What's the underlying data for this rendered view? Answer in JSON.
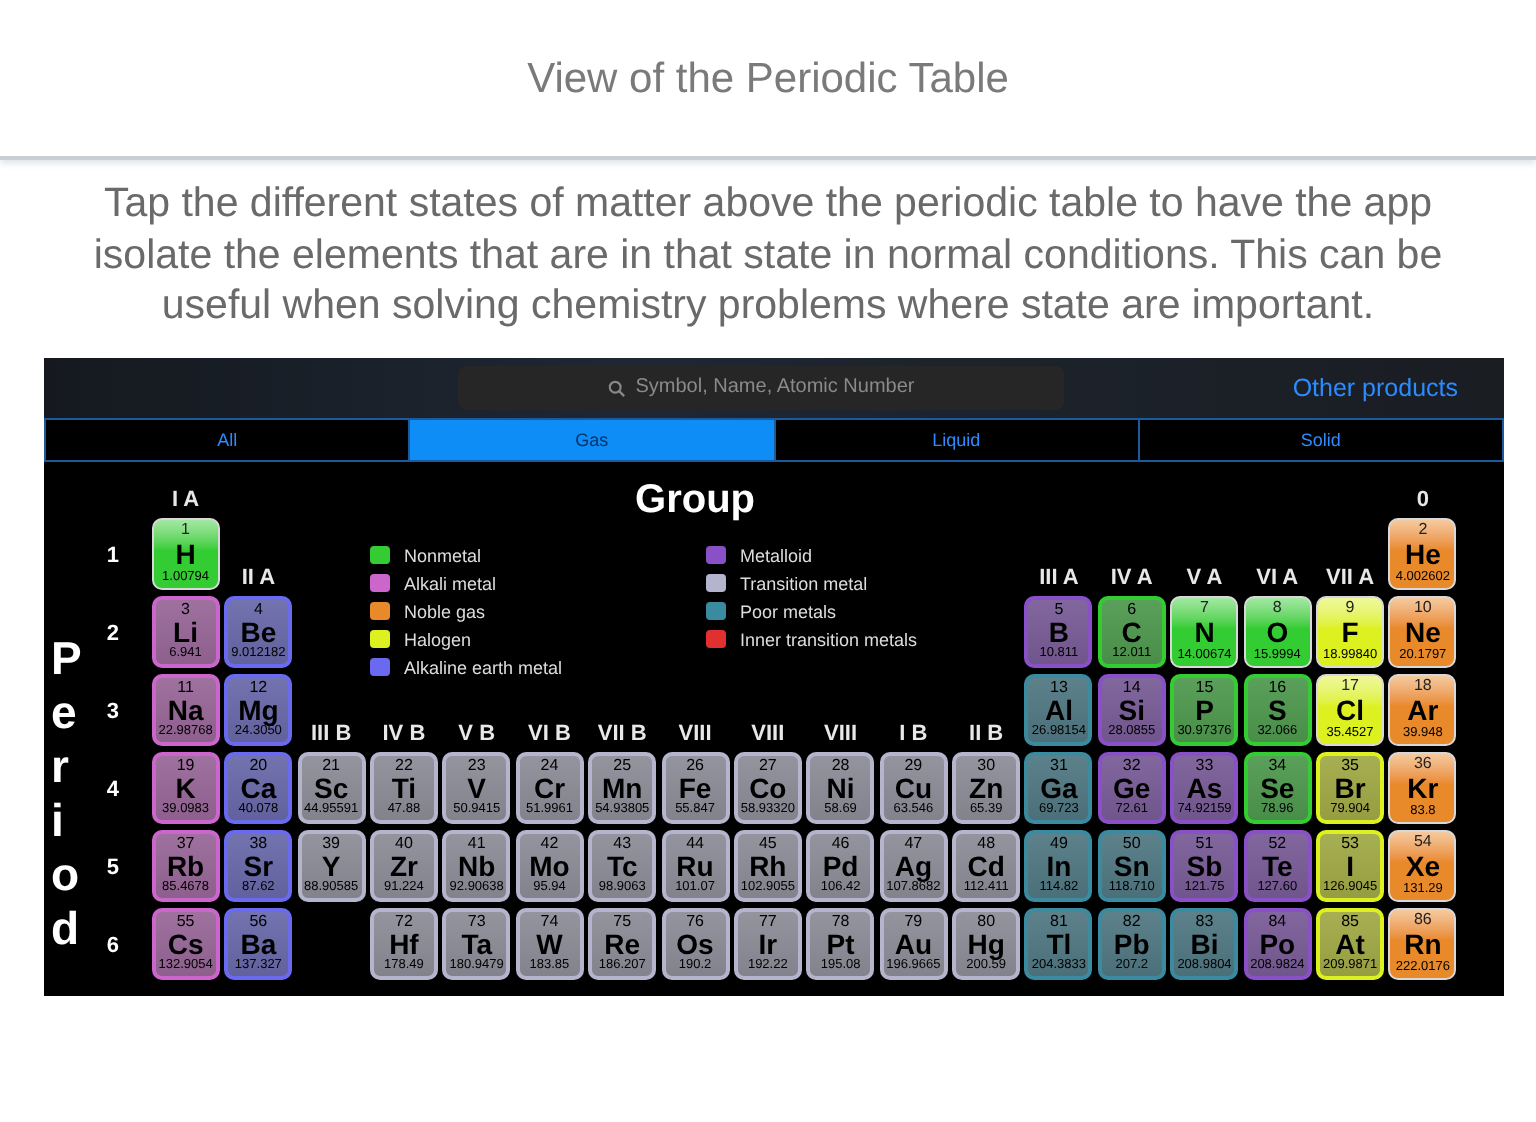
{
  "page_title": "View of the Periodic Table",
  "caption": "Tap the different states of matter above the periodic table to have the app isolate the elements that are in that state in normal conditions. This can be useful when solving chemistry problems where state are important.",
  "search": {
    "placeholder": "Symbol, Name, Atomic Number"
  },
  "other_products": "Other products",
  "tabs": [
    {
      "label": "All",
      "selected": false
    },
    {
      "label": "Gas",
      "selected": true
    },
    {
      "label": "Liquid",
      "selected": false
    },
    {
      "label": "Solid",
      "selected": false
    }
  ],
  "group_axis": "Group",
  "period_axis": "Period",
  "legend": [
    {
      "label": "Nonmetal",
      "color": "#33cc33"
    },
    {
      "label": "Alkali metal",
      "color": "#cc66cc"
    },
    {
      "label": "Noble gas",
      "color": "#e8892a"
    },
    {
      "label": "Halogen",
      "color": "#ddf020"
    },
    {
      "label": "Alkaline earth metal",
      "color": "#6a6af0"
    },
    {
      "label": "Metalloid",
      "color": "#8a50c8"
    },
    {
      "label": "Transition metal",
      "color": "#b4b4cc"
    },
    {
      "label": "Poor metals",
      "color": "#3a8aa0"
    },
    {
      "label": "Inner transition metals",
      "color": "#e03030"
    }
  ],
  "group_labels": [
    "I A",
    "II A",
    "III B",
    "IV B",
    "V B",
    "VI B",
    "VII B",
    "VIII",
    "VIII",
    "VIII",
    "I B",
    "II B",
    "III A",
    "IV A",
    "V A",
    "VI A",
    "VII A",
    "0"
  ],
  "periods": [
    {
      "label": "1",
      "left": [
        {
          "number": "1",
          "symbol": "H",
          "mass": "1.00794",
          "color": "#33cc33",
          "active": true
        }
      ],
      "right": [
        {
          "number": "2",
          "symbol": "He",
          "mass": "4.002602",
          "color": "#e8892a",
          "active": true
        }
      ]
    },
    {
      "label": "2",
      "left": [
        {
          "number": "3",
          "symbol": "Li",
          "mass": "6.941",
          "color": "#cc66cc",
          "active": false
        },
        {
          "number": "4",
          "symbol": "Be",
          "mass": "9.012182",
          "color": "#6a6af0",
          "active": false
        }
      ],
      "right": [
        {
          "number": "5",
          "symbol": "B",
          "mass": "10.811",
          "color": "#8a50c8",
          "active": false
        },
        {
          "number": "6",
          "symbol": "C",
          "mass": "12.011",
          "color": "#33cc33",
          "active": false
        },
        {
          "number": "7",
          "symbol": "N",
          "mass": "14.00674",
          "color": "#33cc33",
          "active": true
        },
        {
          "number": "8",
          "symbol": "O",
          "mass": "15.9994",
          "color": "#33cc33",
          "active": true
        },
        {
          "number": "9",
          "symbol": "F",
          "mass": "18.99840",
          "color": "#ddf020",
          "active": true
        },
        {
          "number": "10",
          "symbol": "Ne",
          "mass": "20.1797",
          "color": "#e8892a",
          "active": true
        }
      ]
    },
    {
      "label": "3",
      "left": [
        {
          "number": "11",
          "symbol": "Na",
          "mass": "22.98768",
          "color": "#cc66cc",
          "active": false
        },
        {
          "number": "12",
          "symbol": "Mg",
          "mass": "24.3050",
          "color": "#6a6af0",
          "active": false
        }
      ],
      "right": [
        {
          "number": "13",
          "symbol": "Al",
          "mass": "26.98154",
          "color": "#3a8aa0",
          "active": false
        },
        {
          "number": "14",
          "symbol": "Si",
          "mass": "28.0855",
          "color": "#8a50c8",
          "active": false
        },
        {
          "number": "15",
          "symbol": "P",
          "mass": "30.97376",
          "color": "#33cc33",
          "active": false
        },
        {
          "number": "16",
          "symbol": "S",
          "mass": "32.066",
          "color": "#33cc33",
          "active": false
        },
        {
          "number": "17",
          "symbol": "Cl",
          "mass": "35.4527",
          "color": "#ddf020",
          "active": true
        },
        {
          "number": "18",
          "symbol": "Ar",
          "mass": "39.948",
          "color": "#e8892a",
          "active": true
        }
      ]
    },
    {
      "label": "4",
      "left": [
        {
          "number": "19",
          "symbol": "K",
          "mass": "39.0983",
          "color": "#cc66cc",
          "active": false
        },
        {
          "number": "20",
          "symbol": "Ca",
          "mass": "40.078",
          "color": "#6a6af0",
          "active": false
        },
        {
          "number": "21",
          "symbol": "Sc",
          "mass": "44.95591",
          "color": "#b4b4cc",
          "active": false
        },
        {
          "number": "22",
          "symbol": "Ti",
          "mass": "47.88",
          "color": "#b4b4cc",
          "active": false
        },
        {
          "number": "23",
          "symbol": "V",
          "mass": "50.9415",
          "color": "#b4b4cc",
          "active": false
        },
        {
          "number": "24",
          "symbol": "Cr",
          "mass": "51.9961",
          "color": "#b4b4cc",
          "active": false
        },
        {
          "number": "25",
          "symbol": "Mn",
          "mass": "54.93805",
          "color": "#b4b4cc",
          "active": false
        },
        {
          "number": "26",
          "symbol": "Fe",
          "mass": "55.847",
          "color": "#b4b4cc",
          "active": false
        },
        {
          "number": "27",
          "symbol": "Co",
          "mass": "58.93320",
          "color": "#b4b4cc",
          "active": false
        },
        {
          "number": "28",
          "symbol": "Ni",
          "mass": "58.69",
          "color": "#b4b4cc",
          "active": false
        },
        {
          "number": "29",
          "symbol": "Cu",
          "mass": "63.546",
          "color": "#b4b4cc",
          "active": false
        },
        {
          "number": "30",
          "symbol": "Zn",
          "mass": "65.39",
          "color": "#b4b4cc",
          "active": false
        }
      ],
      "right": [
        {
          "number": "31",
          "symbol": "Ga",
          "mass": "69.723",
          "color": "#3a8aa0",
          "active": false
        },
        {
          "number": "32",
          "symbol": "Ge",
          "mass": "72.61",
          "color": "#8a50c8",
          "active": false
        },
        {
          "number": "33",
          "symbol": "As",
          "mass": "74.92159",
          "color": "#8a50c8",
          "active": false
        },
        {
          "number": "34",
          "symbol": "Se",
          "mass": "78.96",
          "color": "#33cc33",
          "active": false
        },
        {
          "number": "35",
          "symbol": "Br",
          "mass": "79.904",
          "color": "#ddf020",
          "active": false
        },
        {
          "number": "36",
          "symbol": "Kr",
          "mass": "83.8",
          "color": "#e8892a",
          "active": true
        }
      ]
    },
    {
      "label": "5",
      "left": [
        {
          "number": "37",
          "symbol": "Rb",
          "mass": "85.4678",
          "color": "#cc66cc",
          "active": false
        },
        {
          "number": "38",
          "symbol": "Sr",
          "mass": "87.62",
          "color": "#6a6af0",
          "active": false
        },
        {
          "number": "39",
          "symbol": "Y",
          "mass": "88.90585",
          "color": "#b4b4cc",
          "active": false
        },
        {
          "number": "40",
          "symbol": "Zr",
          "mass": "91.224",
          "color": "#b4b4cc",
          "active": false
        },
        {
          "number": "41",
          "symbol": "Nb",
          "mass": "92.90638",
          "color": "#b4b4cc",
          "active": false
        },
        {
          "number": "42",
          "symbol": "Mo",
          "mass": "95.94",
          "color": "#b4b4cc",
          "active": false
        },
        {
          "number": "43",
          "symbol": "Tc",
          "mass": "98.9063",
          "color": "#b4b4cc",
          "active": false
        },
        {
          "number": "44",
          "symbol": "Ru",
          "mass": "101.07",
          "color": "#b4b4cc",
          "active": false
        },
        {
          "number": "45",
          "symbol": "Rh",
          "mass": "102.9055",
          "color": "#b4b4cc",
          "active": false
        },
        {
          "number": "46",
          "symbol": "Pd",
          "mass": "106.42",
          "color": "#b4b4cc",
          "active": false
        },
        {
          "number": "47",
          "symbol": "Ag",
          "mass": "107.8682",
          "color": "#b4b4cc",
          "active": false
        },
        {
          "number": "48",
          "symbol": "Cd",
          "mass": "112.411",
          "color": "#b4b4cc",
          "active": false
        }
      ],
      "right": [
        {
          "number": "49",
          "symbol": "In",
          "mass": "114.82",
          "color": "#3a8aa0",
          "active": false
        },
        {
          "number": "50",
          "symbol": "Sn",
          "mass": "118.710",
          "color": "#3a8aa0",
          "active": false
        },
        {
          "number": "51",
          "symbol": "Sb",
          "mass": "121.75",
          "color": "#8a50c8",
          "active": false
        },
        {
          "number": "52",
          "symbol": "Te",
          "mass": "127.60",
          "color": "#8a50c8",
          "active": false
        },
        {
          "number": "53",
          "symbol": "I",
          "mass": "126.9045",
          "color": "#ddf020",
          "active": false
        },
        {
          "number": "54",
          "symbol": "Xe",
          "mass": "131.29",
          "color": "#e8892a",
          "active": true
        }
      ]
    },
    {
      "label": "6",
      "left": [
        {
          "number": "55",
          "symbol": "Cs",
          "mass": "132.9054",
          "color": "#cc66cc",
          "active": false
        },
        {
          "number": "56",
          "symbol": "Ba",
          "mass": "137.327",
          "color": "#6a6af0",
          "active": false
        }
      ],
      "right": [
        {
          "number": "72",
          "symbol": "Hf",
          "mass": "178.49",
          "color": "#b4b4cc",
          "active": false
        },
        {
          "number": "73",
          "symbol": "Ta",
          "mass": "180.9479",
          "color": "#b4b4cc",
          "active": false
        },
        {
          "number": "74",
          "symbol": "W",
          "mass": "183.85",
          "color": "#b4b4cc",
          "active": false
        },
        {
          "number": "75",
          "symbol": "Re",
          "mass": "186.207",
          "color": "#b4b4cc",
          "active": false
        },
        {
          "number": "76",
          "symbol": "Os",
          "mass": "190.2",
          "color": "#b4b4cc",
          "active": false
        },
        {
          "number": "77",
          "symbol": "Ir",
          "mass": "192.22",
          "color": "#b4b4cc",
          "active": false
        },
        {
          "number": "78",
          "symbol": "Pt",
          "mass": "195.08",
          "color": "#b4b4cc",
          "active": false
        },
        {
          "number": "79",
          "symbol": "Au",
          "mass": "196.9665",
          "color": "#b4b4cc",
          "active": false
        },
        {
          "number": "80",
          "symbol": "Hg",
          "mass": "200.59",
          "color": "#b4b4cc",
          "active": false
        },
        {
          "number": "81",
          "symbol": "Tl",
          "mass": "204.3833",
          "color": "#3a8aa0",
          "active": false
        },
        {
          "number": "82",
          "symbol": "Pb",
          "mass": "207.2",
          "color": "#3a8aa0",
          "active": false
        },
        {
          "number": "83",
          "symbol": "Bi",
          "mass": "208.9804",
          "color": "#3a8aa0",
          "active": false
        },
        {
          "number": "84",
          "symbol": "Po",
          "mass": "208.9824",
          "color": "#8a50c8",
          "active": false
        },
        {
          "number": "85",
          "symbol": "At",
          "mass": "209.9871",
          "color": "#ddf020",
          "active": false
        },
        {
          "number": "86",
          "symbol": "Rn",
          "mass": "222.0176",
          "color": "#e8892a",
          "active": true
        }
      ]
    }
  ]
}
